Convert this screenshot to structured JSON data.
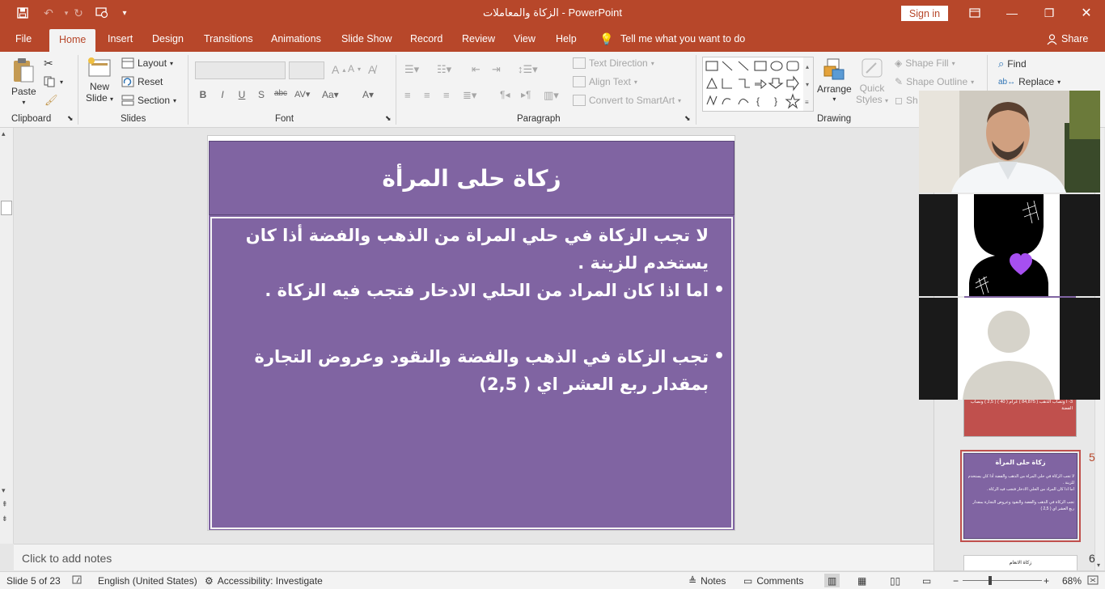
{
  "window": {
    "title": "الزكاة والمعاملات  -  PowerPoint",
    "sign_in": "Sign in"
  },
  "tabs": [
    "File",
    "Home",
    "Insert",
    "Design",
    "Transitions",
    "Animations",
    "Slide Show",
    "Record",
    "Review",
    "View",
    "Help"
  ],
  "active_tab": "Home",
  "tell_me": "Tell me what you want to do",
  "share": "Share",
  "ribbon": {
    "clipboard": {
      "label": "Clipboard",
      "paste": "Paste"
    },
    "slides": {
      "label": "Slides",
      "new_slide_1": "New",
      "new_slide_2": "Slide",
      "layout": "Layout",
      "reset": "Reset",
      "section": "Section"
    },
    "font": {
      "label": "Font"
    },
    "paragraph": {
      "label": "Paragraph",
      "text_direction": "Text Direction",
      "align_text": "Align Text",
      "convert_smartart": "Convert to SmartArt"
    },
    "drawing": {
      "label": "Drawing",
      "arrange": "Arrange",
      "quick_styles_1": "Quick",
      "quick_styles_2": "Styles",
      "shape_fill": "Shape Fill",
      "shape_outline": "Shape Outline",
      "shape_effects": "Sh"
    },
    "editing": {
      "find": "Find",
      "replace": "Replace"
    }
  },
  "slide": {
    "title": "زكاة حلى المرأة",
    "body": [
      {
        "text": "لا تجب الزكاة في حلي المراة من الذهب والفضة أذا كان يستخدم للزينة .",
        "bullet": false
      },
      {
        "text": "اما اذا كان المراد من الحلي الادخار فتجب فيه الزكاة .",
        "bullet": true
      },
      {
        "text": "",
        "bullet": false
      },
      {
        "text": "تجب الزكاة في الذهب والفضة والنقود وعروض التجارة بمقدار ربع العشر اي ( 2,5)",
        "bullet": true
      }
    ]
  },
  "notes_placeholder": "Click to add notes",
  "thumbnails": {
    "prev_text": "3- ا ونصاب  الذهب ( 84,875 ) غرام ( 40 ) ( 2,5 ) ونصاب الفضة",
    "current_num": "5",
    "current_title": "زكاة حلى المرأة",
    "current_lines": [
      "لا تجب الزكاة في حلي المراة من الذهب والفضة أذا كان يستخدم للزينة .",
      "اما اذا كان المراد من الحلي الادخار فتجب فيه الزكاة .",
      "تجب الزكاة في الذهب والفضة والنقود وعروض التجارة بمقدار ربع العشر اي ( 2,5 )"
    ],
    "next_num": "6",
    "next_title": "زكاة الانعام"
  },
  "status": {
    "slide": "Slide 5 of 23",
    "language": "English (United States)",
    "accessibility": "Accessibility: Investigate",
    "notes": "Notes",
    "comments": "Comments",
    "zoom": "68%",
    "zoom_level": 0.68
  },
  "colors": {
    "accent": "#b7472a",
    "slide_bg": "#8064a2"
  }
}
